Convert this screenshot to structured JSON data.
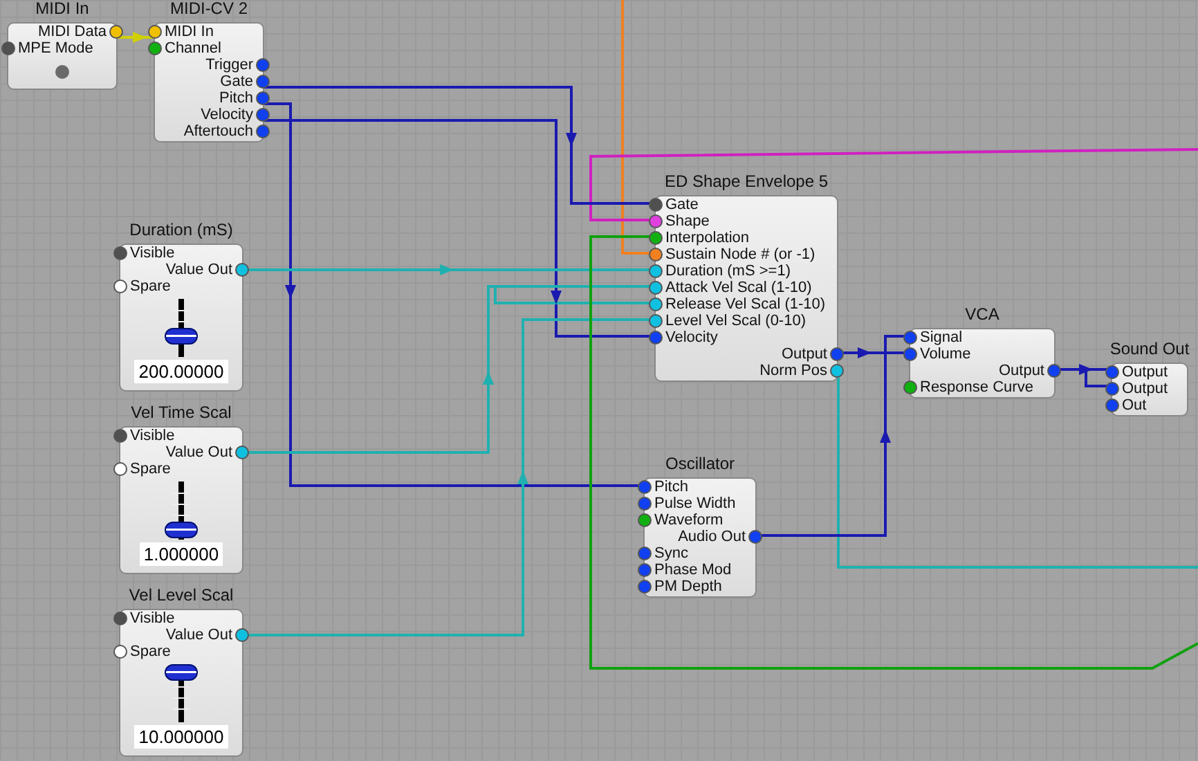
{
  "modules": [
    {
      "title": "MIDI In",
      "kind": "plain",
      "led": true,
      "pins": [
        {
          "label": "MIDI Data",
          "kind": "out",
          "color": "#f0c000"
        },
        {
          "label": "MPE Mode",
          "kind": "in",
          "color": "#505050"
        }
      ]
    },
    {
      "title": "MIDI-CV 2",
      "kind": "plain",
      "pins": [
        {
          "label": "MIDI In",
          "kind": "in",
          "color": "#f0c000"
        },
        {
          "label": "Channel",
          "kind": "in",
          "color": "#10b010"
        },
        {
          "label": "Trigger",
          "kind": "out",
          "color": "#1040f0"
        },
        {
          "label": "Gate",
          "kind": "out",
          "color": "#1040f0"
        },
        {
          "label": "Pitch",
          "kind": "out",
          "color": "#1040f0"
        },
        {
          "label": "Velocity",
          "kind": "out",
          "color": "#1040f0"
        },
        {
          "label": "Aftertouch",
          "kind": "out",
          "color": "#1040f0"
        }
      ]
    },
    {
      "title": "Duration (mS)",
      "kind": "slider",
      "value": "200.00000",
      "level": 0.3,
      "pins": [
        {
          "label": "Visible",
          "kind": "in",
          "color": "#505050"
        },
        {
          "label": "Value Out",
          "kind": "out",
          "color": "#10c0e0"
        },
        {
          "label": "Spare",
          "kind": "in",
          "color": "#ffffff"
        }
      ]
    },
    {
      "title": "Vel Time Scal",
      "kind": "slider",
      "value": "1.000000",
      "level": 0.05,
      "pins": [
        {
          "label": "Visible",
          "kind": "in",
          "color": "#505050"
        },
        {
          "label": "Value Out",
          "kind": "out",
          "color": "#10c0e0"
        },
        {
          "label": "Spare",
          "kind": "in",
          "color": "#ffffff"
        }
      ]
    },
    {
      "title": "Vel Level Scal",
      "kind": "slider",
      "value": "10.000000",
      "level": 1,
      "pins": [
        {
          "label": "Visible",
          "kind": "in",
          "color": "#505050"
        },
        {
          "label": "Value Out",
          "kind": "out",
          "color": "#10c0e0"
        },
        {
          "label": "Spare",
          "kind": "in",
          "color": "#ffffff"
        }
      ]
    },
    {
      "title": "ED Shape Envelope 5",
      "kind": "plain",
      "pins": [
        {
          "label": "Gate",
          "kind": "in",
          "color": "#505050"
        },
        {
          "label": "Shape",
          "kind": "in",
          "color": "#e040e0"
        },
        {
          "label": "Interpolation",
          "kind": "in",
          "color": "#10b010"
        },
        {
          "label": "Sustain Node # (or -1)",
          "kind": "in",
          "color": "#f08020"
        },
        {
          "label": "Duration (mS >=1)",
          "kind": "in",
          "color": "#10c0e0"
        },
        {
          "label": "Attack Vel Scal (1-10)",
          "kind": "in",
          "color": "#10c0e0"
        },
        {
          "label": "Release Vel Scal (1-10)",
          "kind": "in",
          "color": "#10c0e0"
        },
        {
          "label": "Level Vel Scal (0-10)",
          "kind": "in",
          "color": "#10c0e0"
        },
        {
          "label": "Velocity",
          "kind": "in",
          "color": "#1040f0"
        },
        {
          "label": "Output",
          "kind": "out",
          "color": "#1040f0"
        },
        {
          "label": "Norm Pos",
          "kind": "out",
          "color": "#10c0e0"
        }
      ]
    },
    {
      "title": "VCA",
      "kind": "plain",
      "pins": [
        {
          "label": "Signal",
          "kind": "in",
          "color": "#1040f0"
        },
        {
          "label": "Volume",
          "kind": "in",
          "color": "#1040f0"
        },
        {
          "label": "Output",
          "kind": "out",
          "color": "#1040f0"
        },
        {
          "label": "Response Curve",
          "kind": "in",
          "color": "#10b010"
        }
      ]
    },
    {
      "title": "Sound Out",
      "kind": "plain",
      "pins": [
        {
          "label": "Output",
          "kind": "in",
          "color": "#1040f0"
        },
        {
          "label": "Output",
          "kind": "in",
          "color": "#1040f0"
        },
        {
          "label": "Out",
          "kind": "in",
          "color": "#1040f0"
        }
      ]
    },
    {
      "title": "Oscillator",
      "kind": "plain",
      "pins": [
        {
          "label": "Pitch",
          "kind": "in",
          "color": "#1040f0"
        },
        {
          "label": "Pulse Width",
          "kind": "in",
          "color": "#1040f0"
        },
        {
          "label": "Waveform",
          "kind": "in",
          "color": "#10b010"
        },
        {
          "label": "Audio Out",
          "kind": "out",
          "color": "#1040f0"
        },
        {
          "label": "Sync",
          "kind": "in",
          "color": "#1040f0"
        },
        {
          "label": "Phase Mod",
          "kind": "in",
          "color": "#1040f0"
        },
        {
          "label": "PM Depth",
          "kind": "in",
          "color": "#1040f0"
        }
      ]
    }
  ]
}
